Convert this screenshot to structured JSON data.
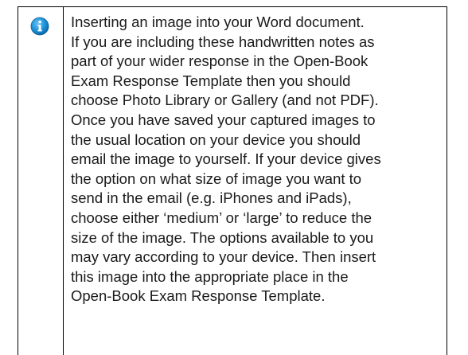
{
  "note": {
    "icon": "info-icon",
    "icon_color": "#1a8fd6",
    "text": "Inserting an image into your Word document.\nIf you are including these handwritten notes as\npart of your wider response in the Open-Book\nExam Response Template then you should\nchoose Photo Library or Gallery (and not PDF).\nOnce you have saved your captured images to\nthe usual location on your device you should\nemail the image to yourself. If your device gives\nthe option on what size of image you want to\nsend in the email (e.g. iPhones and iPads),\nchoose either ‘medium’ or ‘large’ to reduce the\nsize of the image. The options available to you\nmay vary according to your device. Then insert\nthis image into the appropriate place in the\nOpen-Book Exam Response Template."
  }
}
